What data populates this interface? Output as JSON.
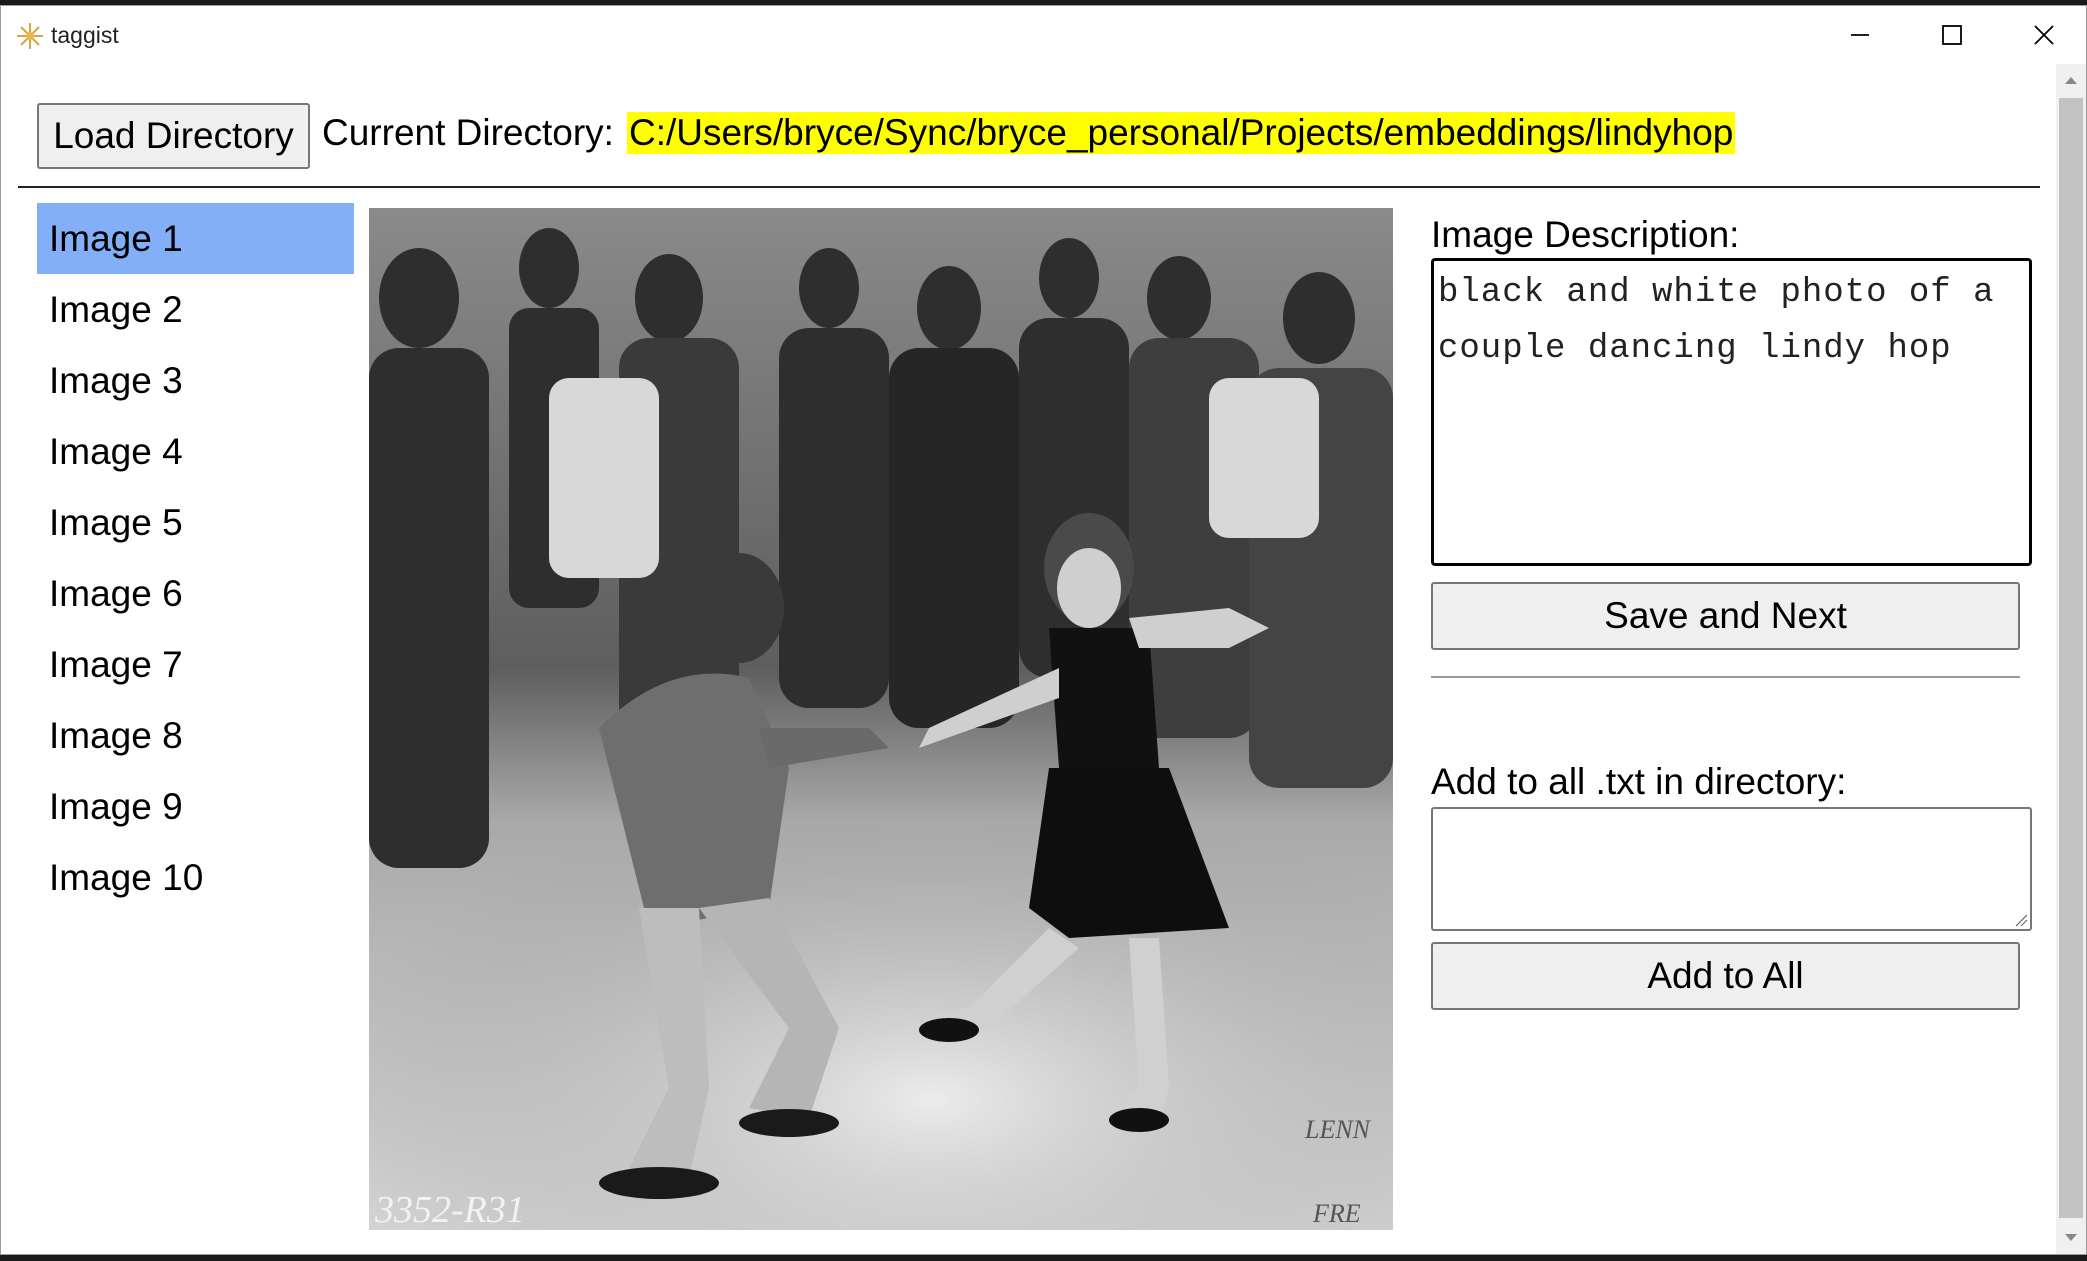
{
  "window": {
    "title": "taggist",
    "icon": "sparkle-icon",
    "controls": [
      "minimize-icon",
      "maximize-icon",
      "close-icon"
    ]
  },
  "toolbar": {
    "load_label": "Load Directory",
    "current_dir_label": "Current Directory:",
    "current_dir_path": "C:/Users/bryce/Sync/bryce_personal/Projects/embeddings/lindyhop",
    "highlight_color": "#ffff00"
  },
  "image_list": {
    "selected_index": 0,
    "selected_color": "#82aff7",
    "items": [
      "Image 1",
      "Image 2",
      "Image 3",
      "Image 4",
      "Image 5",
      "Image 6",
      "Image 7",
      "Image 8",
      "Image 9",
      "Image 10"
    ]
  },
  "photo": {
    "caption_marks": [
      "3352-R31",
      "LENN",
      "FRE"
    ]
  },
  "editor": {
    "description_label": "Image Description:",
    "description_value": "black and white photo of a couple dancing lindy hop",
    "save_label": "Save and Next",
    "add_label": "Add to all .txt in directory:",
    "add_value": "",
    "add_all_label": "Add to All"
  },
  "scrollbar": {
    "up_icon": "arrow-up-icon",
    "down_icon": "arrow-down-icon"
  }
}
